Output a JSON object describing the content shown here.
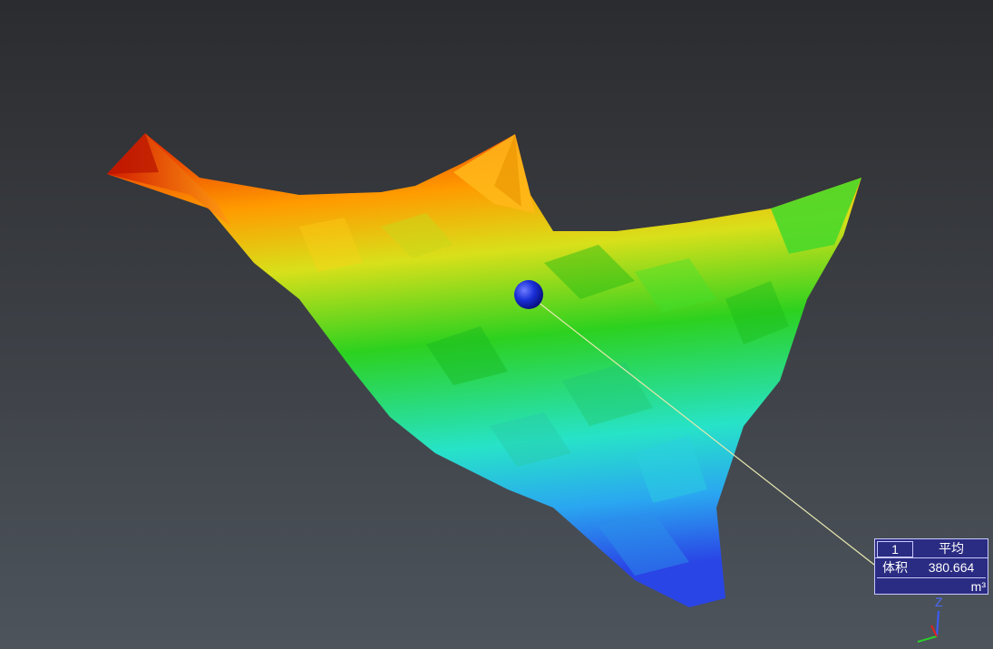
{
  "label": {
    "id": "1",
    "stat": "平均",
    "name": "体积",
    "value": "380.664",
    "unit": "m³"
  },
  "axes": {
    "z_label": "Z"
  },
  "colors": {
    "marker": "#1020c8",
    "leader_line": "#e8e8b0",
    "label_bg": "#2a2b82"
  }
}
